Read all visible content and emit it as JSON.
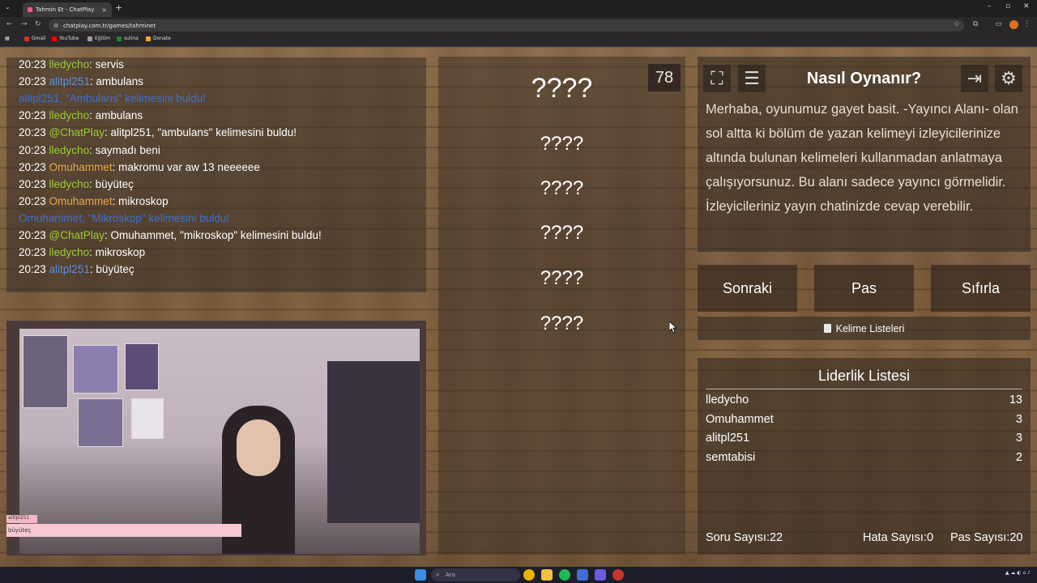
{
  "browser": {
    "tab_title": "Tahmin Et - ChatPlay",
    "url": "chatplay.com.tr/games/tahminet",
    "bookmarks": [
      {
        "label": "Gmail",
        "color": "#d93025"
      },
      {
        "label": "YouTube",
        "color": "#ff0000"
      },
      {
        "label": "Eğitim",
        "color": "#9e9e9e"
      },
      {
        "label": "sulina",
        "color": "#2e7d32"
      },
      {
        "label": "Donate",
        "color": "#f9a825"
      }
    ]
  },
  "chat": {
    "lines": [
      {
        "ts": "20:23",
        "user": "lledycho",
        "user_color": "#9acd32",
        "text": ": servis"
      },
      {
        "ts": "20:23",
        "user": "alitpl251",
        "user_color": "#5b8fd9",
        "text": ": ambulans"
      },
      {
        "ts": "",
        "user": "alitpl251,",
        "user_color": "#3d6fd1",
        "text": " \"Ambulans\" kelimesini buldu!",
        "text_color": "#3d6fd1"
      },
      {
        "ts": "20:23",
        "user": "lledycho",
        "user_color": "#9acd32",
        "text": ": ambulans"
      },
      {
        "ts": "20:23",
        "user": "@ChatPlay",
        "user_color": "#9acd32",
        "text": ": alitpl251, \"ambulans\" kelimesini buldu!"
      },
      {
        "ts": "20:23",
        "user": "lledycho",
        "user_color": "#9acd32",
        "text": ": saymadı beni"
      },
      {
        "ts": "20:23",
        "user": "Omuhammet",
        "user_color": "#e8a64c",
        "text": ": makromu var aw 13 neeeeee"
      },
      {
        "ts": "20:23",
        "user": "lledycho",
        "user_color": "#9acd32",
        "text": ": büyüteç"
      },
      {
        "ts": "20:23",
        "user": "Omuhammet",
        "user_color": "#e8a64c",
        "text": ": mikroskop"
      },
      {
        "ts": "",
        "user": "Omuhammet,",
        "user_color": "#3d6fd1",
        "text": " \"Mikroskop\" kelimesini buldu!",
        "text_color": "#3d6fd1"
      },
      {
        "ts": "20:23",
        "user": "@ChatPlay",
        "user_color": "#9acd32",
        "text": ": Omuhammet, \"mikroskop\" kelimesini buldu!"
      },
      {
        "ts": "20:23",
        "user": "lledycho",
        "user_color": "#9acd32",
        "text": ": mikroskop"
      },
      {
        "ts": "20:23",
        "user": "alitpl251",
        "user_color": "#5b8fd9",
        "text": ": büyüteç"
      }
    ]
  },
  "webcam": {
    "overlay_user": "alitpl251",
    "overlay_text": "büyüteç"
  },
  "game": {
    "timer": "78",
    "words": [
      "????",
      "????",
      "????",
      "????",
      "????",
      "????"
    ]
  },
  "howto": {
    "title": "Nasıl Oynanır?",
    "text": "Merhaba, oyunumuz gayet basit. -Yayıncı Alanı- olan sol altta ki bölüm de yazan kelimeyi izleyicilerinize altında bulunan kelimeleri kullanmadan anlatmaya çalışıyorsunuz. Bu alanı sadece yayıncı görmelidir. İzleyicileriniz yayın chatinizde cevap verebilir."
  },
  "actions": {
    "next": "Sonraki",
    "pass": "Pas",
    "reset": "Sıfırla",
    "word_lists": "Kelime Listeleri"
  },
  "leaderboard": {
    "title": "Liderlik Listesi",
    "rows": [
      {
        "name": "lledycho",
        "score": "13"
      },
      {
        "name": "Omuhammet",
        "score": "3"
      },
      {
        "name": "alitpl251",
        "score": "3"
      },
      {
        "name": "semtabisi",
        "score": "2"
      }
    ],
    "question_count": "Soru Sayısı:22",
    "error_count": "Hata Sayısı:0",
    "pass_count": "Pas Sayısı:20"
  },
  "taskbar": {
    "search_placeholder": "Ara"
  }
}
